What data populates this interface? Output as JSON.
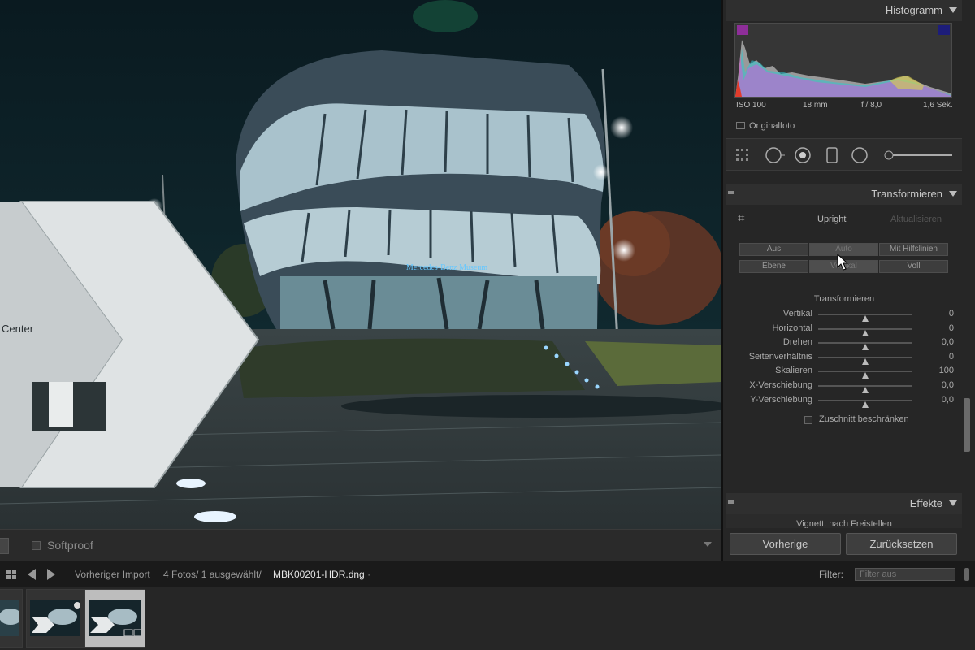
{
  "photo": {
    "sign_text": "Center",
    "building_sign": "Mercedes-Benz Museum"
  },
  "toolbar": {
    "softproof_label": "Softproof"
  },
  "panel": {
    "histogram": {
      "title": "Histogramm",
      "iso": "ISO 100",
      "focal": "18 mm",
      "aperture": "f / 8,0",
      "shutter": "1,6 Sek.",
      "original_label": "Originalfoto"
    },
    "transform": {
      "title": "Transformieren",
      "upright_label": "Upright",
      "update_label": "Aktualisieren",
      "buttons_row1": [
        "Aus",
        "Auto",
        "Mit Hilfslinien"
      ],
      "buttons_row2": [
        "Ebene",
        "Vertikal",
        "Voll"
      ],
      "sub_title": "Transformieren",
      "sliders": [
        {
          "label": "Vertikal",
          "value": "0",
          "pos": 0.5
        },
        {
          "label": "Horizontal",
          "value": "0",
          "pos": 0.5
        },
        {
          "label": "Drehen",
          "value": "0,0",
          "pos": 0.5
        },
        {
          "label": "Seitenverhältnis",
          "value": "0",
          "pos": 0.5
        },
        {
          "label": "Skalieren",
          "value": "100",
          "pos": 0.5
        },
        {
          "label": "X-Verschiebung",
          "value": "0,0",
          "pos": 0.5
        },
        {
          "label": "Y-Verschiebung",
          "value": "0,0",
          "pos": 0.5
        }
      ],
      "constrain_label": "Zuschnitt beschränken"
    },
    "effects": {
      "title": "Effekte",
      "vignette_label": "Vignett. nach Freistellen"
    },
    "previous_button": "Vorherige",
    "reset_button": "Zurücksetzen"
  },
  "filmstrip": {
    "source": "Vorheriger Import",
    "count": "4 Fotos/ 1 ausgewählt/",
    "filename": "MBK00201-HDR.dng",
    "filename_suffix": "·",
    "filter_label": "Filter:",
    "filter_value": "Filter aus"
  },
  "colors": {
    "panel_bg": "#262626",
    "header_bg": "#2f2f2f",
    "selected_thumb": "#bdbdbd"
  }
}
